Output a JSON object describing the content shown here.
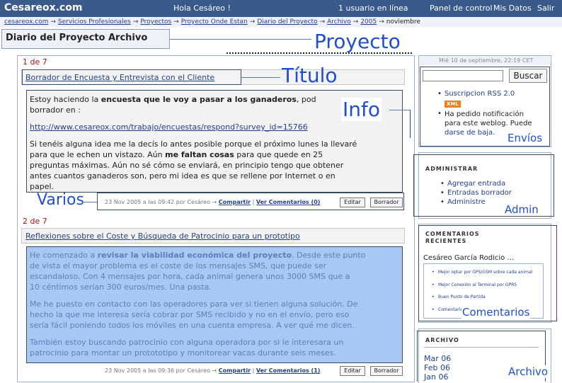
{
  "header": {
    "site_name": "Cesareox.com",
    "greeting": "Hola Cesáreo !",
    "online": "1 usuario en línea",
    "nav": [
      "Panel de control",
      "Mis Datos",
      "Salir"
    ]
  },
  "breadcrumb": [
    "cesareox.com",
    "Servicios Profesionales",
    "Proyectos",
    "Proyecto Onde Estan",
    "Diario del Proyecto",
    "Archivo",
    "2005",
    "noviembre"
  ],
  "breadcrumb_sep": "→",
  "page_title": "Diario del Proyecto Archivo",
  "annotations": {
    "proyecto": "Proyecto",
    "titulo": "Título",
    "info": "Info",
    "varios": "Varios",
    "envios": "Envíos",
    "admin": "Admin",
    "comentarios": "Comentarios",
    "archivo": "Archivo"
  },
  "posts": [
    {
      "counter": "1 de 7",
      "title": "Borrador de Encuesta y Entrevista con el Cliente",
      "lines": [
        [
          "Estoy haciendo la ",
          "encuesta que le voy a pasar a los ganaderos",
          ", pod"
        ],
        [
          "borrador en :"
        ],
        [
          "http://www.cesareox.com/trabajo/encuestas/respond?survey_id=15766"
        ],
        [
          "Si tenéis alguna idea me la decís lo antes posible porque el próximo lunes la llevaré"
        ],
        [
          "para que le echen un vistazo. Aún ",
          "me faltan cosas",
          " para que quede en 25"
        ],
        [
          "preguntas máximas. Aún no sé cómo se enviará, en principio tengo que obtener"
        ],
        [
          "antes cuantos ganaderos son, pero mi idea es que se rellene por Internet o en"
        ],
        [
          "papel."
        ]
      ],
      "meta": "23 Nov 2005 a las 09:42 por Cesáreo →",
      "share": "Compartir",
      "comments": "Ver Comentarios (0)",
      "edit": "Editar",
      "delete": "Borrador"
    },
    {
      "counter": "2 de 7",
      "title": "Reflexiones sobre el Coste y Búsqueda de Patrocinio para un prototipo",
      "lines": [
        [
          "He comenzado a ",
          "revisar la viabilidad económica del proyecto",
          ". Desde este punto"
        ],
        [
          "de vista el mayor problema es el coste de los mensajes SMS, que puede ser"
        ],
        [
          "escandaloso. Con 4 mensajes por hora, cada animal genera unos 3000 SMS que a"
        ],
        [
          "10 céntimos serían 300 euros/mes. Una pasta."
        ],
        [
          ""
        ],
        [
          "Me he puesto en contacto con las operadores para ver si tienen alguna solución. De"
        ],
        [
          "hecho la que me interesa sería cobrar por SMS recibido y no en el envío, pero eso"
        ],
        [
          "sería fácil poniendo todos los móviles en una cuenta empresa. A ver qué me dicen."
        ],
        [
          ""
        ],
        [
          "También estoy buscando patrocinio con alguna operadora por si le interesara un"
        ],
        [
          "patrocinio para montar un protototipo y monitorear vacas durante seis meses."
        ]
      ],
      "meta": "23 Nov 2005 a las 09:36 por Cesáreo →",
      "share": "Compartir",
      "comments": "Ver Comentarios (1)",
      "edit": "Editar",
      "delete": "Borrador"
    }
  ],
  "sidebar": {
    "date": "Mié 10 de septiembre, 22:19 CET",
    "search_value": "",
    "search_button": "Buscar",
    "rss": "Suscripcion RSS 2.0",
    "xml_badge": "XML",
    "notify_lines": [
      "Ha pedido notificación",
      "para este weblog. Puede"
    ],
    "unsubscribe": "darse de baja",
    "unsubscribe_end": ".",
    "admin_heading": "ADMINISTRAR",
    "admin_items": [
      "Agregar entrada",
      "Entradas borrador",
      "Administre"
    ],
    "comments_heading": [
      "COMENTARIOS",
      "RECIENTES"
    ],
    "comments_author": "Cesáreo García Rodicio ...",
    "comment_items": [
      "Mejor optar por GPS/GSM sobre cada animal",
      "Mejor Conexión al Terminal por GPRS",
      "Buen Punto de Partida",
      "Comentarios"
    ],
    "archive_heading": "ARCHIVO",
    "archive_items": [
      "Mar 06",
      "Feb 06",
      "Jan 06"
    ]
  },
  "colors": {
    "topbar": "#3a5a8c",
    "link": "#23408e",
    "annotation": "#1f4fd0",
    "counter": "#a11",
    "xml_badge": "#f08020"
  }
}
